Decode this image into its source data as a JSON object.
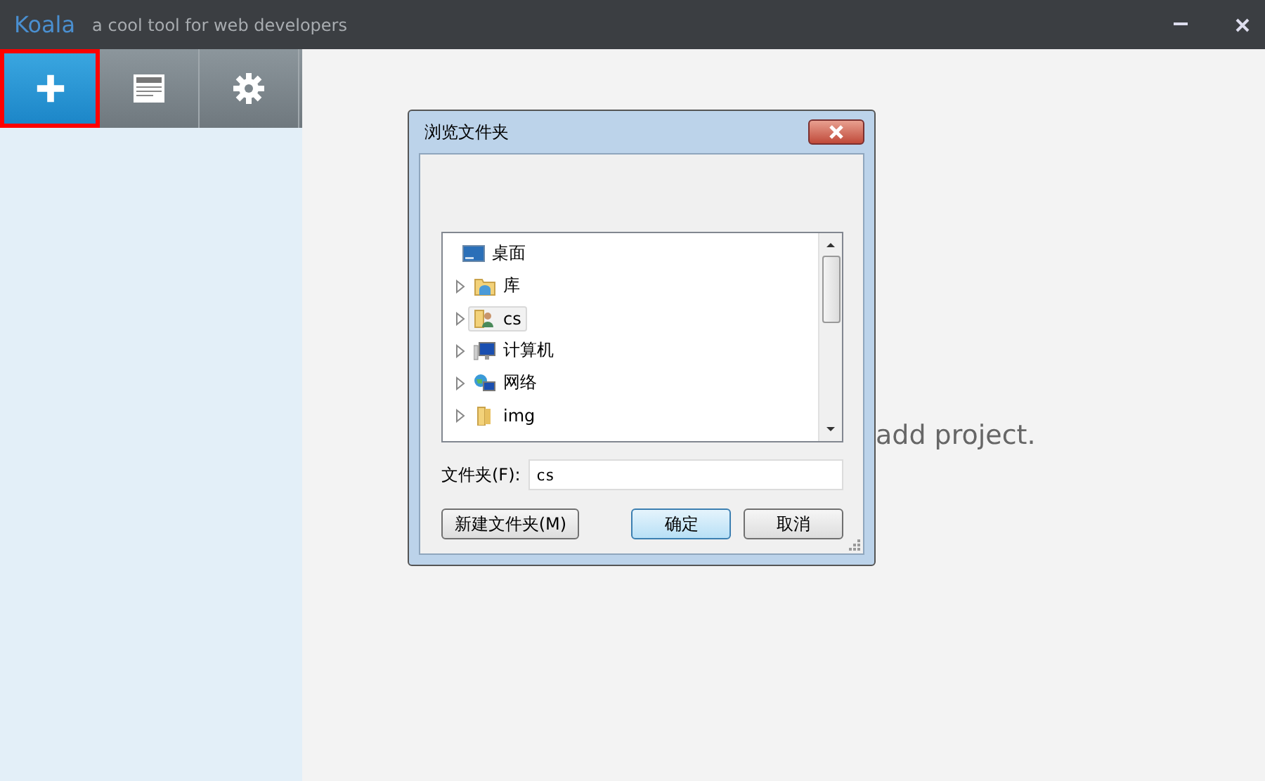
{
  "window": {
    "title": "Koala",
    "subtitle": "a cool tool for web developers",
    "controls": [
      {
        "kind": "minimize"
      },
      {
        "kind": "close"
      }
    ]
  },
  "toolbar": [
    {
      "kind": "add",
      "selected": true
    },
    {
      "kind": "document",
      "selected": false
    },
    {
      "kind": "settings",
      "selected": false
    }
  ],
  "main": {
    "hint": "add project."
  },
  "dialog": {
    "title": "浏览文件夹",
    "tree": [
      {
        "label": "桌面",
        "kind": "desktop",
        "expandable": false,
        "selected": false
      },
      {
        "label": "库",
        "kind": "library",
        "expandable": true,
        "selected": false
      },
      {
        "label": "cs",
        "kind": "user",
        "expandable": true,
        "selected": true
      },
      {
        "label": "计算机",
        "kind": "computer",
        "expandable": true,
        "selected": false
      },
      {
        "label": "网络",
        "kind": "network",
        "expandable": true,
        "selected": false
      },
      {
        "label": "img",
        "kind": "folder",
        "expandable": true,
        "selected": false
      }
    ],
    "folder_label": "文件夹(F):",
    "folder_value": "cs",
    "buttons": [
      {
        "label": "新建文件夹(M)",
        "default": false
      },
      {
        "label": "确定",
        "default": true
      },
      {
        "label": "取消",
        "default": false
      }
    ]
  }
}
